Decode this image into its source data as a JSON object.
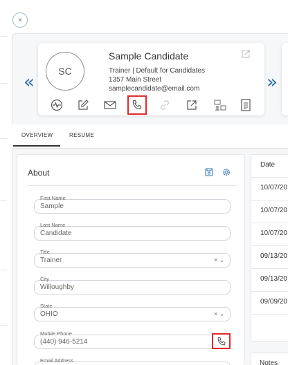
{
  "close": {
    "icon": "×"
  },
  "nav": {
    "prev_icon": "«",
    "next_icon": "»"
  },
  "candidate": {
    "initials": "SC",
    "name": "Sample Candidate",
    "role_line": "Trainer | Default for Candidates",
    "address": "1357 Main Street",
    "email": "samplecandidate@email.com"
  },
  "actions": [
    {
      "name": "activity-icon"
    },
    {
      "name": "edit-icon"
    },
    {
      "name": "email-icon"
    },
    {
      "name": "phone-icon",
      "highlighted": true
    },
    {
      "name": "link-icon"
    },
    {
      "name": "open-external-icon"
    },
    {
      "name": "org-chart-icon"
    },
    {
      "name": "document-icon"
    }
  ],
  "tabs": [
    {
      "label": "OVERVIEW",
      "active": true
    },
    {
      "label": "RESUME",
      "active": false
    }
  ],
  "about": {
    "title": "About",
    "fields": [
      {
        "label": "First Name",
        "value": "Sample",
        "type": "text"
      },
      {
        "label": "Last Name",
        "value": "Candidate",
        "type": "text"
      },
      {
        "label": "Title",
        "value": "Trainer",
        "type": "select"
      },
      {
        "label": "City",
        "value": "Willoughby",
        "type": "text"
      },
      {
        "label": "State",
        "value": "OHIO",
        "type": "select"
      },
      {
        "label": "Mobile Phone",
        "value": "(440) 946-5214",
        "type": "phone"
      },
      {
        "label": "Email Address",
        "value": "",
        "type": "text"
      }
    ]
  },
  "table": {
    "header": "Date",
    "rows": [
      "10/07/20",
      "10/07/20",
      "10/07/20",
      "09/13/20",
      "09/13/20",
      "09/09/20"
    ]
  },
  "notes": {
    "label": "Notes"
  }
}
